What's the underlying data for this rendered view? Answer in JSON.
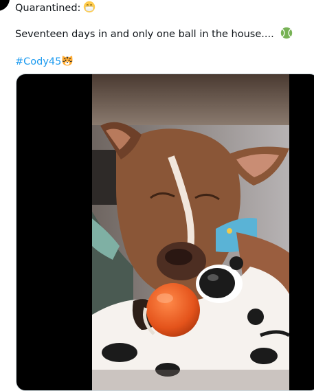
{
  "tweet": {
    "line1": "Quarantined:",
    "line2": "Seventeen days in and only one ball in the house....",
    "hashtag": "#Cody45"
  },
  "icons": {
    "line1_emoji": "face-with-medical-mask-icon",
    "line2_emoji": "tennis-ball-icon",
    "hashtag_emoji": "tiger-face-icon"
  },
  "colors": {
    "hashtag": "#1d9bf0",
    "text": "#0f1419"
  }
}
